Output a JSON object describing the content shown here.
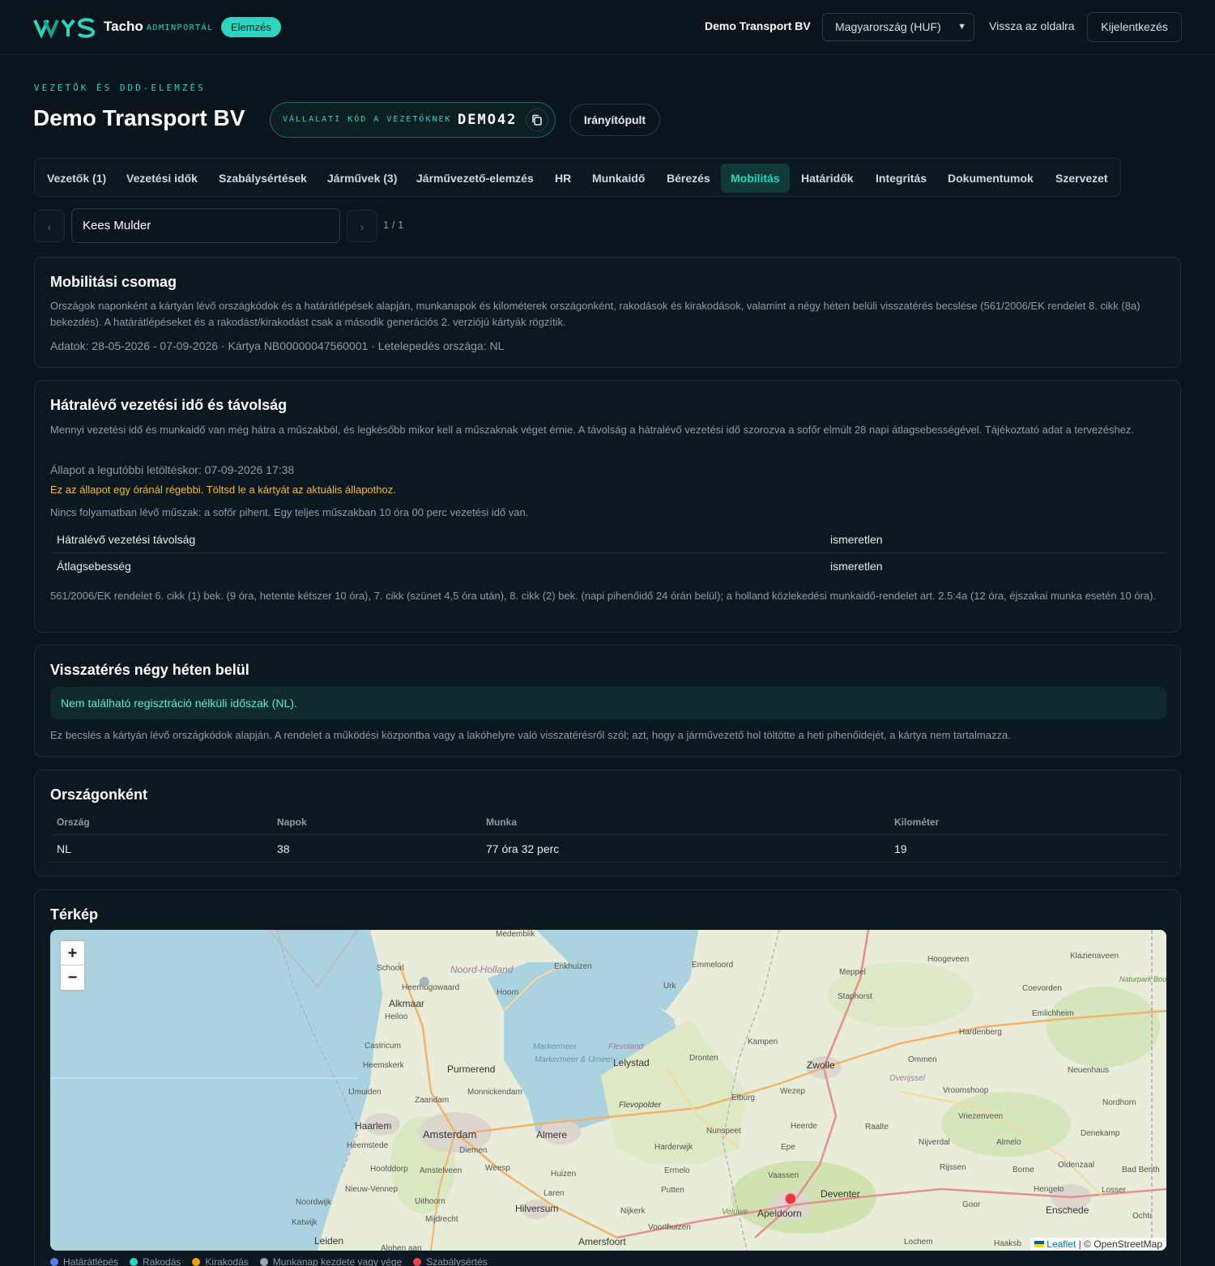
{
  "header": {
    "brand": "Tacho",
    "brand_sub": "ADMINPORTÁL",
    "badge": "Elemzés",
    "company": "Demo Transport BV",
    "country_select": "Magyarország (HUF)",
    "back_link": "Vissza az oldalra",
    "logout": "Kijelentkezés"
  },
  "page": {
    "eyebrow": "VEZETŐK ÉS DDD-ELEMZÉS",
    "title": "Demo Transport BV",
    "code_label": "VÁLLALATI KÓD A VEZETŐKNEK",
    "code_value": "DEMO42",
    "dashboard_button": "Irányítópult"
  },
  "tabs": [
    {
      "label": "Vezetők (1)"
    },
    {
      "label": "Vezetési idők"
    },
    {
      "label": "Szabálysértések"
    },
    {
      "label": "Járművek (3)"
    },
    {
      "label": "Járművezető-elemzés"
    },
    {
      "label": "HR"
    },
    {
      "label": "Munkaidő"
    },
    {
      "label": "Bérezés"
    },
    {
      "label": "Mobilitás"
    },
    {
      "label": "Határidők"
    },
    {
      "label": "Integritás"
    },
    {
      "label": "Dokumentumok"
    },
    {
      "label": "Szervezet"
    }
  ],
  "active_tab": "Mobilitás",
  "driver_selector": {
    "prev": "‹",
    "next": "›",
    "driver": "Kees Mulder",
    "counter": "1 / 1"
  },
  "mobility_card": {
    "title": "Mobilitási csomag",
    "description": "Országok naponként a kártyán lévő országkódok és a határátlépések alapján, munkanapok és kilométerek országonként, rakodások és kirakodások, valamint a négy héten belüli visszatérés becslése (561/2006/EK rendelet 8. cikk (8a) bekezdés). A határátlépéseket és a rakodást/kirakodást csak a második generációs 2. verziójú kártyák rögzítik.",
    "meta": "Adatok: 28-05-2026 - 07-09-2026 · Kártya NB00000047560001 · Letelepedés országa: NL"
  },
  "remaining_card": {
    "title": "Hátralévő vezetési idő és távolság",
    "description": "Mennyi vezetési idő és munkaidő van még hátra a műszakból, és legkésőbb mikor kell a műszaknak véget érnie. A távolság a hátralévő vezetési idő szorozva a sofőr elmúlt 28 napi átlagsebességével. Tájékoztató adat a tervezéshez.",
    "status": "Állapot a legutóbbi letöltéskor: 07-09-2026 17:38",
    "warning": "Ez az állapot egy óránál régebbi. Töltsd le a kártyát az aktuális állapothoz.",
    "no_shift": "Nincs folyamatban lévő műszak: a sofőr pihent. Egy teljes műszakban 10 óra 00 perc vezetési idő van.",
    "rows": [
      {
        "label": "Hátralévő vezetési távolság",
        "value": "ismeretlen"
      },
      {
        "label": "Átlagsebesség",
        "value": "ismeretlen"
      }
    ],
    "footnote": "561/2006/EK rendelet 6. cikk (1) bek. (9 óra, hetente kétszer 10 óra), 7. cikk (szünet 4,5 óra után), 8. cikk (2) bek. (napi pihenőidő 24 órán belül); a holland közlekedési munkaidő-rendelet art. 2.5:4a (12 óra, éjszakai munka esetén 10 óra)."
  },
  "return_card": {
    "title": "Visszatérés négy héten belül",
    "info": "Nem található regisztráció nélküli időszak (NL).",
    "note": "Ez becslés a kártyán lévő országkódok alapján. A rendelet a működési központba vagy a lakóhelyre való visszatérésről szól; azt, hogy a járművezető hol töltötte a heti pihenőidejét, a kártya nem tartalmazza."
  },
  "country_card": {
    "title": "Országonként",
    "headers": [
      "Ország",
      "Napok",
      "Munka",
      "Kilométer"
    ],
    "rows": [
      {
        "country": "NL",
        "days": "38",
        "work": "77 óra 32 perc",
        "km": "19"
      }
    ]
  },
  "map_card": {
    "title": "Térkép",
    "zoom_in": "+",
    "zoom_out": "−",
    "attribution_leaflet": "Leaflet",
    "attribution_osm": "| © OpenStreetMap",
    "places": {
      "medemblik": "Medemblik",
      "noord_holland": "Noord-Holland",
      "enkhuizen": "Enkhuizen",
      "schoorl": "Schoorl",
      "heerhugowaard": "Heerhugowaard",
      "hoorn": "Hoorn",
      "alkmaar": "Alkmaar",
      "heiloo": "Heiloo",
      "castricum": "Castricum",
      "heemskerk": "Heemskerk",
      "purmerend": "Purmerend",
      "markermeer": "Markermeer",
      "markermeer_ijmeer": "Markermeer & IJmeer",
      "flevoland": "Flevoland",
      "lelystad": "Lelystad",
      "ijmuiden": "IJmuiden",
      "zaandam": "Zaandam",
      "monnickendam": "Monnickendam",
      "haarlem": "Haarlem",
      "heemstede": "Heemstede",
      "amsterdam": "Amsterdam",
      "diemen": "Diemen",
      "almere": "Almere",
      "hoofddorp": "Hoofddorp",
      "amstelveen": "Amstelveen",
      "weesp": "Weesp",
      "huizen": "Huizen",
      "nieuw_vennep": "Nieuw-Vennep",
      "laren": "Laren",
      "uithoorn": "Uithoorn",
      "hilversum": "Hilversum",
      "noordwijk": "Noordwijk",
      "katwijk": "Katwijk",
      "mijdrecht": "Mijdrecht",
      "leiden": "Leiden",
      "alphen": "Alphen aan",
      "amersfoort": "Amersfoort",
      "emmeloord": "Emmeloord",
      "urk": "Urk",
      "meppel": "Meppel",
      "staphorst": "Staphorst",
      "hoogeveen": "Hoogeveen",
      "klazienaveen": "Klazienaveen",
      "coevorden": "Coevorden",
      "emlichheim": "Emlichheim",
      "naturpark": "Naturpark Bourtanger Moor Veenland",
      "kampen": "Kampen",
      "dronten": "Dronten",
      "zwolle": "Zwolle",
      "hardenberg": "Hardenberg",
      "ommen": "Ommen",
      "overijssel": "Overijssel",
      "neuenhaus": "Neuenhaus",
      "flevopolder": "Flevopolder",
      "elburg": "Elburg",
      "wezep": "Wezep",
      "vroomshoop": "Vroomshoop",
      "nordhorn": "Nordhorn",
      "vriezenveen": "Vriezenveen",
      "nunspeet": "Nunspeet",
      "heerde": "Heerde",
      "raalte": "Raalte",
      "denekamp": "Denekamp",
      "harderwijk": "Harderwijk",
      "epe": "Epe",
      "nijverdal": "Nijverdal",
      "almelo": "Almelo",
      "ermelo": "Ermelo",
      "vaassen": "Vaassen",
      "rijssen": "Rijssen",
      "borne": "Borne",
      "oldenzaal": "Oldenzaal",
      "bad_bentheim": "Bad Benth",
      "putten": "Putten",
      "deventer": "Deventer",
      "hengelo": "Hengelo",
      "losser": "Losser",
      "nijkerk": "Nijkerk",
      "veluwe": "Veluwe",
      "apeldoorn": "Apeldoorn",
      "goor": "Goor",
      "enschede": "Enschede",
      "ochtr": "Ochtr",
      "voorthuizen": "Voorthuizen",
      "lochem": "Lochem",
      "haaksb": "Haaksb"
    }
  },
  "legend": [
    {
      "label": "Határátlépés",
      "color": "#5b7cfa"
    },
    {
      "label": "Rakodás",
      "color": "#2dd4bf"
    },
    {
      "label": "Kirakodás",
      "color": "#f59e0b"
    },
    {
      "label": "Munkanap kezdete vagy vége",
      "color": "#9aa5ad"
    },
    {
      "label": "Szabálysértés",
      "color": "#ef4444"
    }
  ],
  "colors": {
    "accent": "#2dd4bf",
    "background": "#0a141c",
    "card": "#0c1820",
    "warning": "#f5b942",
    "marker": "#e23a3a"
  }
}
